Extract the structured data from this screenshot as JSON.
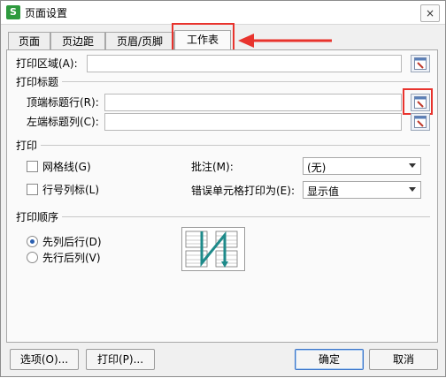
{
  "window": {
    "title": "页面设置",
    "app_icon_letter": "S",
    "close_glyph": "×"
  },
  "tabs": [
    {
      "label": "页面"
    },
    {
      "label": "页边距"
    },
    {
      "label": "页眉/页脚"
    },
    {
      "label": "工作表",
      "active": true
    }
  ],
  "print_area": {
    "label": "打印区域(A):",
    "value": ""
  },
  "print_titles": {
    "heading": "打印标题",
    "top_rows_label": "顶端标题行(R):",
    "top_rows_value": "",
    "left_cols_label": "左端标题列(C):",
    "left_cols_value": ""
  },
  "print": {
    "heading": "打印",
    "gridlines_label": "网格线(G)",
    "gridlines_checked": false,
    "rowcol_headers_label": "行号列标(L)",
    "rowcol_headers_checked": false,
    "comments_label": "批注(M):",
    "comments_value": "(无)",
    "errors_label": "错误单元格打印为(E):",
    "errors_value": "显示值"
  },
  "print_order": {
    "heading": "打印顺序",
    "down_then_over_label": "先列后行(D)",
    "over_then_down_label": "先行后列(V)",
    "selected": "down_then_over"
  },
  "footer": {
    "options_label": "选项(O)...",
    "print_label": "打印(P)...",
    "ok_label": "确定",
    "cancel_label": "取消"
  },
  "colors": {
    "annotation_red": "#e8332d",
    "selection_blue": "#2a5fb0",
    "app_icon_green": "#2e9a3e",
    "order_arrow_teal": "#1e8a8a"
  }
}
